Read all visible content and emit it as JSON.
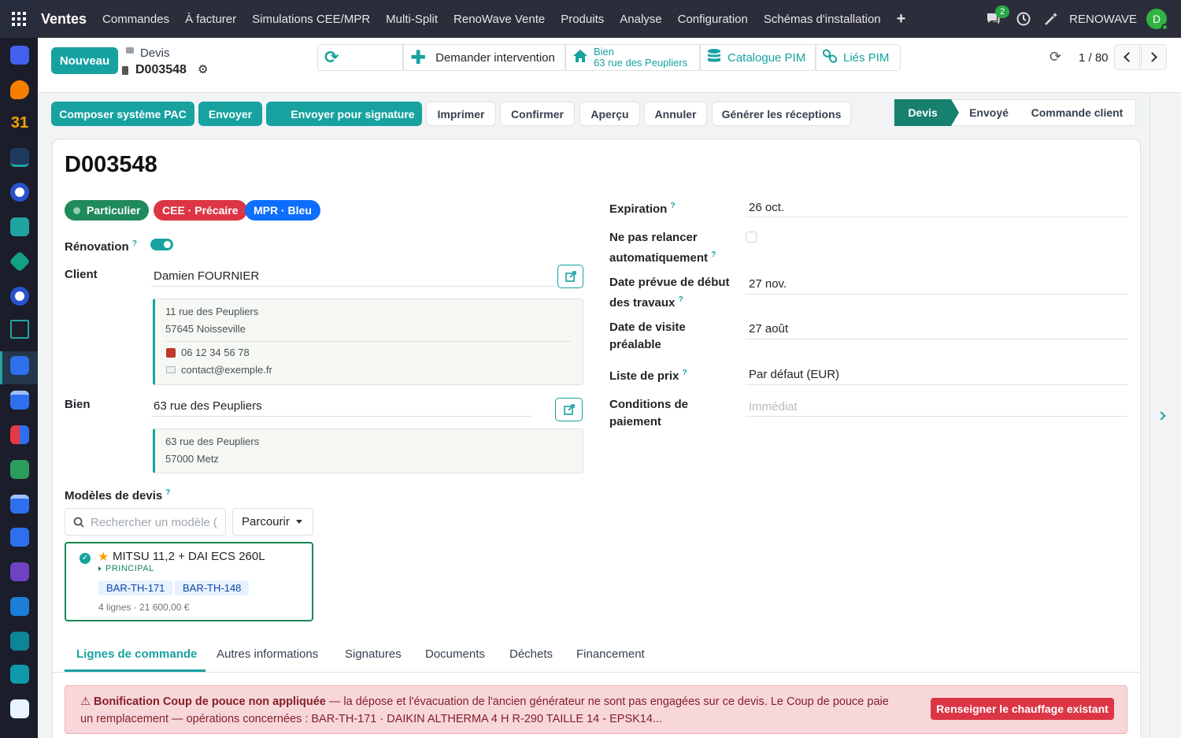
{
  "topbar": {
    "brand": "Ventes",
    "menu": [
      "Commandes",
      "À facturer",
      "Simulations CEE/MPR",
      "Multi-Split",
      "RenoWave Vente",
      "Produits",
      "Analyse",
      "Configuration",
      "Schémas d'installation"
    ],
    "chat_badge": "2",
    "company": "RENOWAVE",
    "avatar_letter": "D"
  },
  "control": {
    "new_label": "Nouveau",
    "breadcrumb_parent": "Devis",
    "record_name": "D003548",
    "request_intervention": "Demander intervention",
    "bien_label": "Bien",
    "bien_value": "63 rue des Peupliers",
    "catalogue": "Catalogue PIM",
    "linked": "Liés PIM",
    "pager": "1 / 80"
  },
  "actions": {
    "compose": "Composer système PAC",
    "send": "Envoyer",
    "send_sign": "Envoyer pour signature",
    "print": "Imprimer",
    "confirm": "Confirmer",
    "preview": "Aperçu",
    "cancel": "Annuler",
    "receptions": "Générer les réceptions"
  },
  "status": {
    "steps": [
      "Devis",
      "Envoyé",
      "Commande client"
    ],
    "active": "Devis"
  },
  "form": {
    "title": "D003548",
    "tags": [
      "Particulier",
      "CEE · Précaire",
      "MPR · Bleu"
    ],
    "tag_colors": [
      "#1f8a5b",
      "#dc3545",
      "#0d6efd"
    ],
    "renovation_label": "Rénovation",
    "client_label": "Client",
    "client_value": "Damien FOURNIER",
    "client_addr1": "11 rue des Peupliers",
    "client_addr2": "57645 Noisseville",
    "client_phone": "06 12 34 56 78",
    "client_email": "contact@exemple.fr",
    "bien_label": "Bien",
    "bien_value": "63 rue des Peupliers",
    "bien_addr1": "63 rue des Peupliers",
    "bien_addr2": "57000 Metz",
    "models_label": "Modèles de devis",
    "search_placeholder": "Rechercher un modèle (",
    "browse": "Parcourir",
    "model_title": "MITSU 11,2 + DAI ECS 260L",
    "model_sub": "PRINCIPAL",
    "model_chips": [
      "BAR-TH-171",
      "BAR-TH-148"
    ],
    "model_meta": "4 lignes · 21 600,00 €",
    "expiration_label": "Expiration",
    "expiration_value": "26 oct.",
    "no_followup_l1": "Ne pas relancer",
    "no_followup_l2": "automatiquement",
    "start_l1": "Date prévue de début",
    "start_l2": "des travaux",
    "start_value": "27 nov.",
    "visit_l1": "Date de visite",
    "visit_l2": "préalable",
    "visit_value": "27 août",
    "pricelist_label": "Liste de prix",
    "pricelist_value": "Par défaut (EUR)",
    "terms_l1": "Conditions de",
    "terms_l2": "paiement",
    "terms_placeholder": "Immédiat"
  },
  "tabs": [
    "Lignes de commande",
    "Autres informations",
    "Signatures",
    "Documents",
    "Déchets",
    "Financement"
  ],
  "alert": {
    "title": "Bonification Coup de pouce non appliquée",
    "line1": " — la dépose et l'évacuation de l'ancien générateur ne sont pas engagées sur ce devis. Le Coup de pouce paie",
    "line2": "un remplacement — opérations concernées : BAR-TH-171 · DAIKIN ALTHERMA 4 H R-290 TAILLE 14 - EPSK14...",
    "button": "Renseigner le chauffage existant"
  }
}
